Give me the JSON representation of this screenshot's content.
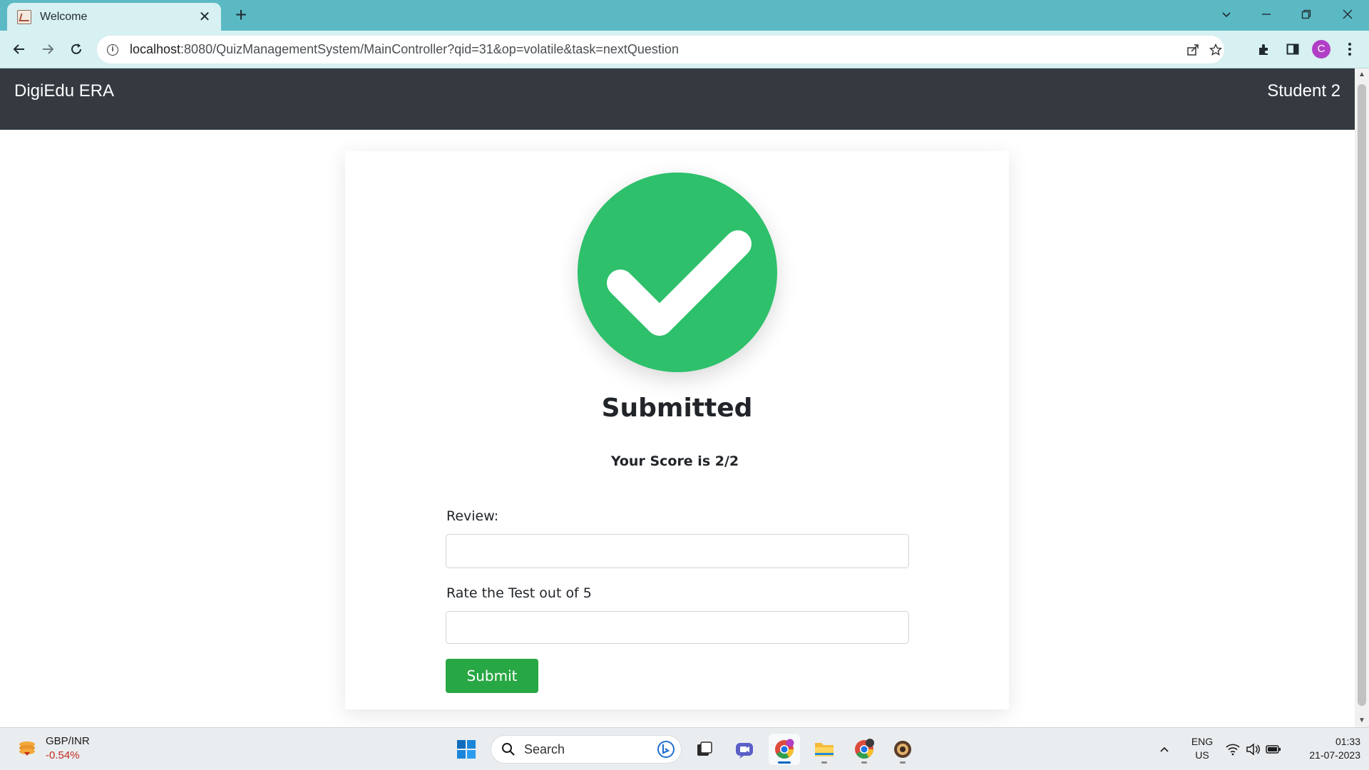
{
  "browser": {
    "tab_title": "Welcome",
    "tab_close": "✕",
    "new_tab": "+",
    "url_host": "localhost",
    "url_rest": ":8080/QuizManagementSystem/MainController?qid=31&op=volatile&task=nextQuestion",
    "profile_initial": "C"
  },
  "navbar": {
    "brand": "DigiEdu ERA",
    "user": "Student 2"
  },
  "result": {
    "title": "Submitted",
    "score": "Your Score is 2/2",
    "check_color": "#2ec06b"
  },
  "form": {
    "review_label": "Review:",
    "review_value": "",
    "rating_label": "Rate the Test out of 5",
    "rating_value": "",
    "submit_label": "Submit",
    "submit_color": "#28a745"
  },
  "taskbar": {
    "ticker_name": "GBP/INR",
    "ticker_change": "-0.54%",
    "search_label": "Search",
    "lang_line1": "ENG",
    "lang_line2": "US",
    "time": "01:33",
    "date": "21-07-2023",
    "apps": [
      "windows-start-icon",
      "bing-icon",
      "task-view-icon",
      "teams-chat-icon",
      "chrome-icon",
      "file-explorer-icon",
      "chrome-profile-icon",
      "app-icon"
    ]
  }
}
